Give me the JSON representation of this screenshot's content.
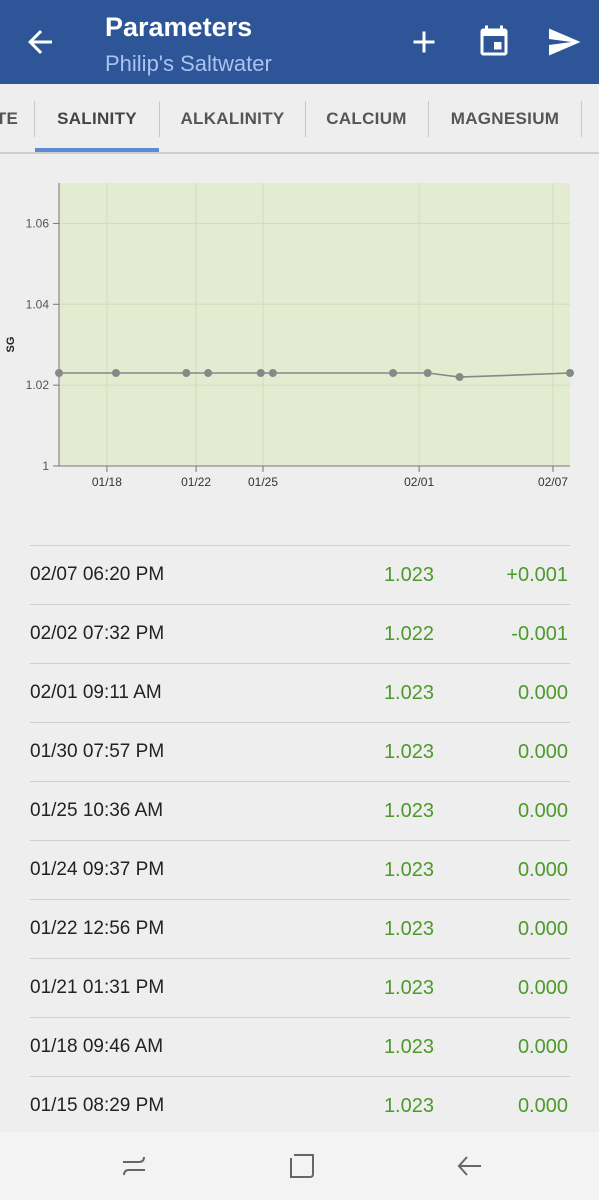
{
  "appbar": {
    "title": "Parameters",
    "subtitle": "Philip's Saltwater",
    "back_icon": "arrow-left-icon",
    "actions": [
      "plus-icon",
      "calendar-icon",
      "send-icon"
    ],
    "color": "#2e5597"
  },
  "tabs": [
    {
      "label": "TE"
    },
    {
      "label": "SALINITY",
      "active": true
    },
    {
      "label": "ALKALINITY"
    },
    {
      "label": "CALCIUM"
    },
    {
      "label": "MAGNESIUM"
    }
  ],
  "chart_data": {
    "type": "line",
    "ylabel": "SG",
    "ylim": [
      1.0,
      1.07
    ],
    "yticks": [
      "1",
      "1.02",
      "1.04",
      "1.06"
    ],
    "xlim": [
      "01/15",
      "02/07"
    ],
    "xticks": [
      "01/18",
      "01/22",
      "01/25",
      "02/01",
      "02/07"
    ],
    "plot_background": "#e3ebd0",
    "line_color": "#888888",
    "series": [
      {
        "points": [
          {
            "x": "01/15 08:29 PM",
            "y": 1.023
          },
          {
            "x": "01/18 09:46 AM",
            "y": 1.023
          },
          {
            "x": "01/21 01:31 PM",
            "y": 1.023
          },
          {
            "x": "01/22 12:56 PM",
            "y": 1.023
          },
          {
            "x": "01/24 09:37 PM",
            "y": 1.023
          },
          {
            "x": "01/25 10:36 AM",
            "y": 1.023
          },
          {
            "x": "01/30 07:57 PM",
            "y": 1.023
          },
          {
            "x": "02/01 09:11 AM",
            "y": 1.023
          },
          {
            "x": "02/02 07:32 PM",
            "y": 1.022
          },
          {
            "x": "02/07 06:20 PM",
            "y": 1.023
          }
        ]
      }
    ]
  },
  "readings": [
    {
      "date": "02/07 06:20 PM",
      "value": "1.023",
      "delta": "+0.001"
    },
    {
      "date": "02/02 07:32 PM",
      "value": "1.022",
      "delta": "-0.001"
    },
    {
      "date": "02/01 09:11 AM",
      "value": "1.023",
      "delta": "0.000"
    },
    {
      "date": "01/30 07:57 PM",
      "value": "1.023",
      "delta": "0.000"
    },
    {
      "date": "01/25 10:36 AM",
      "value": "1.023",
      "delta": "0.000"
    },
    {
      "date": "01/24 09:37 PM",
      "value": "1.023",
      "delta": "0.000"
    },
    {
      "date": "01/22 12:56 PM",
      "value": "1.023",
      "delta": "0.000"
    },
    {
      "date": "01/21 01:31 PM",
      "value": "1.023",
      "delta": "0.000"
    },
    {
      "date": "01/18 09:46 AM",
      "value": "1.023",
      "delta": "0.000"
    },
    {
      "date": "01/15 08:29 PM",
      "value": "1.023",
      "delta": "0.000"
    }
  ],
  "navbar": [
    "recents-icon",
    "home-icon",
    "back-icon"
  ],
  "value_color": "#4c9a2a"
}
